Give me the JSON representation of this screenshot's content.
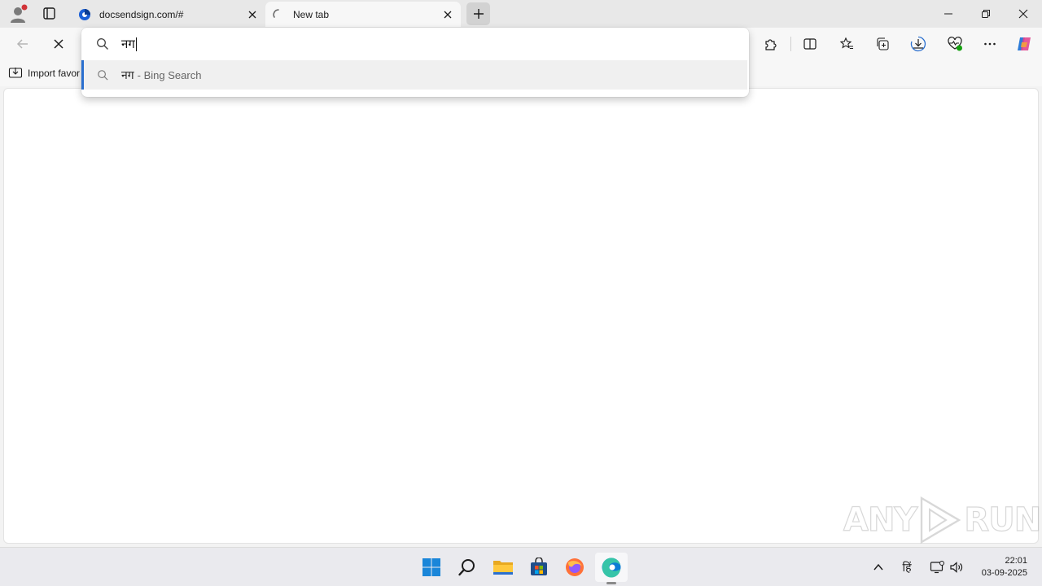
{
  "tabs": [
    {
      "title": "docsendsign.com/#",
      "active": false
    },
    {
      "title": "New tab",
      "active": true
    }
  ],
  "omnibox": {
    "query": "नग",
    "suggestion": {
      "text": "नग",
      "suffix": "- Bing Search"
    }
  },
  "favorites_bar": {
    "import_label": "Import favor"
  },
  "watermark": {
    "left": "ANY",
    "right": "RUN"
  },
  "taskbar": {
    "apps": [
      "start-icon",
      "search-icon",
      "file-explorer-icon",
      "microsoft-store-icon",
      "firefox-icon",
      "edge-icon"
    ],
    "tray": {
      "ime_label": "हिं"
    },
    "clock": {
      "time": "22:01",
      "date": "03-09-2025"
    }
  },
  "colors": {
    "accent": "#2a6fcf",
    "tabstrip": "#e8e8e8",
    "toolbar": "#f7f7f7"
  }
}
